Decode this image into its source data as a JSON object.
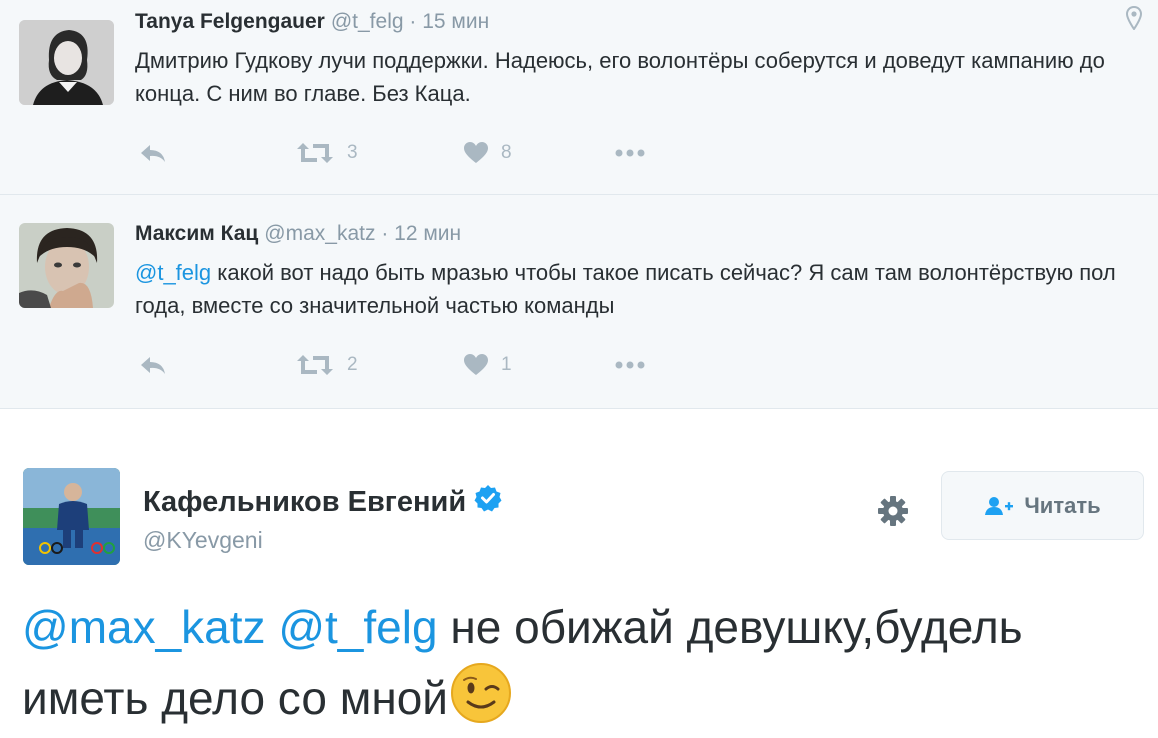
{
  "tweets": [
    {
      "name": "Tanya Felgengauer",
      "handle": "@t_felg",
      "separator": "·",
      "time": "15 мин",
      "text": "Дмитрию Гудкову лучи поддержки. Надеюсь, его волонтёры соберутся и доведут кампанию до конца. С ним во главе. Без Каца.",
      "retweets": "3",
      "likes": "8"
    },
    {
      "name": "Максим Кац",
      "handle": "@max_katz",
      "separator": "·",
      "time": "12 мин",
      "mention": "@t_felg",
      "text": " какой вот надо быть мразью чтобы такое писать сейчас? Я сам там волонтёрствую пол года, вместе со значительной частью команды",
      "retweets": "2",
      "likes": "1"
    }
  ],
  "main_tweet": {
    "name": "Кафельников Евгений",
    "handle": "@KYevgeni",
    "follow_label": "Читать",
    "mention1": "@max_katz",
    "mention2": "@t_felg",
    "text": " не обижай девушку,будель иметь дело со мной"
  },
  "icons": {
    "reply": "reply-icon",
    "retweet": "retweet-icon",
    "like": "heart-icon",
    "more": "more-icon",
    "location": "location-pin-icon",
    "verified": "verified-badge-icon",
    "settings": "gear-icon",
    "follow": "follow-person-icon",
    "emoji": "wink-emoji-icon"
  },
  "colors": {
    "link": "#1b95e0",
    "muted": "#8899a6",
    "action_icon": "#aab8c2",
    "compact_bg": "#f5f8fa",
    "text": "#292f33"
  }
}
